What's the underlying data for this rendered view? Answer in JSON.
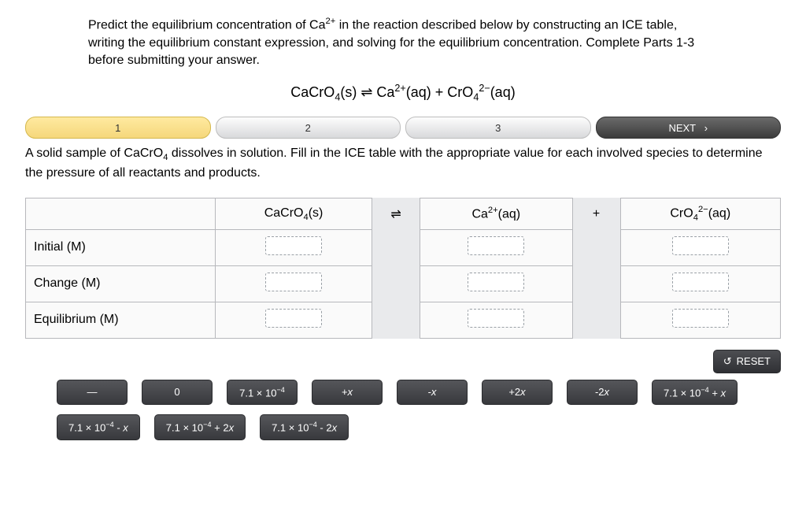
{
  "instructions_html": "Predict the equilibrium concentration of Ca<sup>2+</sup> in the reaction described below by constructing an ICE table, writing the equilibrium constant expression, and solving for the equilibrium concentration. Complete Parts 1-3 before submitting your answer.",
  "equation_html": "CaCrO<sub>4</sub>(s) &#8652; Ca<sup>2+</sup>(aq) + CrO<sub>4</sub><sup>2&#8722;</sup>(aq)",
  "stepper": {
    "items": [
      {
        "label": "1",
        "state": "active"
      },
      {
        "label": "2",
        "state": ""
      },
      {
        "label": "3",
        "state": ""
      },
      {
        "label": "NEXT   ›",
        "state": "next"
      }
    ]
  },
  "part_text_html": "A solid sample of CaCrO<sub>4</sub> dissolves in solution. Fill in the ICE table with the appropriate value for each involved species to determine the pressure of all reactants and products.",
  "ice_table": {
    "headers_html": [
      "",
      "CaCrO<sub>4</sub>(s)",
      "&#8652;",
      "Ca<sup>2+</sup>(aq)",
      "+",
      "CrO<sub>4</sub><sup>2&#8722;</sup>(aq)"
    ],
    "rows": [
      {
        "label": "Initial (M)"
      },
      {
        "label": "Change (M)"
      },
      {
        "label": "Equilibrium (M)"
      }
    ]
  },
  "reset_label": "RESET",
  "tiles_row1_html": [
    "&#8212;",
    "0",
    "7.1 &times; 10<sup>&#8722;4</sup>",
    "+<span class='x'>x</span>",
    "-<span class='x'>x</span>",
    "+2<span class='x'>x</span>",
    "-2<span class='x'>x</span>",
    "7.1 &times; 10<sup>&#8722;4</sup> + <span class='x'>x</span>"
  ],
  "tiles_row2_html": [
    "7.1 &times; 10<sup>&#8722;4</sup> - <span class='x'>x</span>",
    "7.1 &times; 10<sup>&#8722;4</sup> + 2<span class='x'>x</span>",
    "7.1 &times; 10<sup>&#8722;4</sup> - 2<span class='x'>x</span>"
  ]
}
